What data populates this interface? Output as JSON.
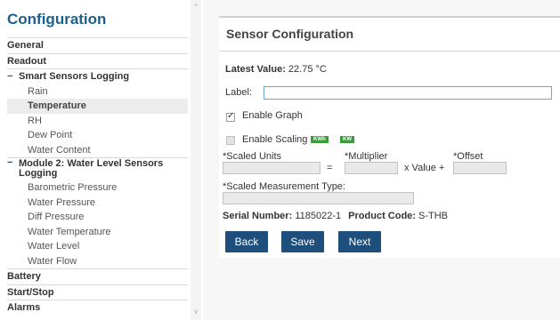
{
  "sidebar": {
    "title": "Configuration",
    "items": [
      {
        "label": "General"
      },
      {
        "label": "Readout"
      },
      {
        "label": "Smart Sensors Logging"
      },
      {
        "label": "Rain"
      },
      {
        "label": "Temperature"
      },
      {
        "label": "RH"
      },
      {
        "label": "Dew Point"
      },
      {
        "label": "Water Content"
      },
      {
        "label": "Module 2: Water Level Sensors Logging"
      },
      {
        "label": "Barometric Pressure"
      },
      {
        "label": "Water Pressure"
      },
      {
        "label": "Diff Pressure"
      },
      {
        "label": "Water Temperature"
      },
      {
        "label": "Water Level"
      },
      {
        "label": "Water Flow"
      },
      {
        "label": "Battery"
      },
      {
        "label": "Start/Stop"
      },
      {
        "label": "Alarms"
      }
    ],
    "expand_symbol": "−",
    "active_item": "Temperature"
  },
  "scrollbar": {
    "up": "^",
    "down": "v"
  },
  "panel": {
    "title": "Sensor Configuration",
    "latest_value_label": "Latest Value:",
    "latest_value": "22.75 °C",
    "label_field_label": "Label:",
    "label_value": "",
    "enable_graph_label": "Enable Graph",
    "enable_graph_checked": true,
    "enable_scaling_label": "Enable Scaling",
    "enable_scaling_checked": false,
    "badges": [
      "KWh",
      "KW"
    ],
    "scaled_units_label": "*Scaled Units",
    "equals": "=",
    "multiplier_label": "*Multiplier",
    "x_value_plus": "x Value +",
    "offset_label": "*Offset",
    "scaled_measurement_type_label": "*Scaled Measurement Type:",
    "serial_number_label": "Serial Number:",
    "serial_number": "1185022-1",
    "product_code_label": "Product Code:",
    "product_code": "S-THB",
    "buttons": {
      "back": "Back",
      "save": "Save",
      "next": "Next"
    }
  },
  "colors": {
    "accent": "#1f5f8b",
    "button": "#1d4e7c",
    "badge": "#3a9b3a"
  }
}
